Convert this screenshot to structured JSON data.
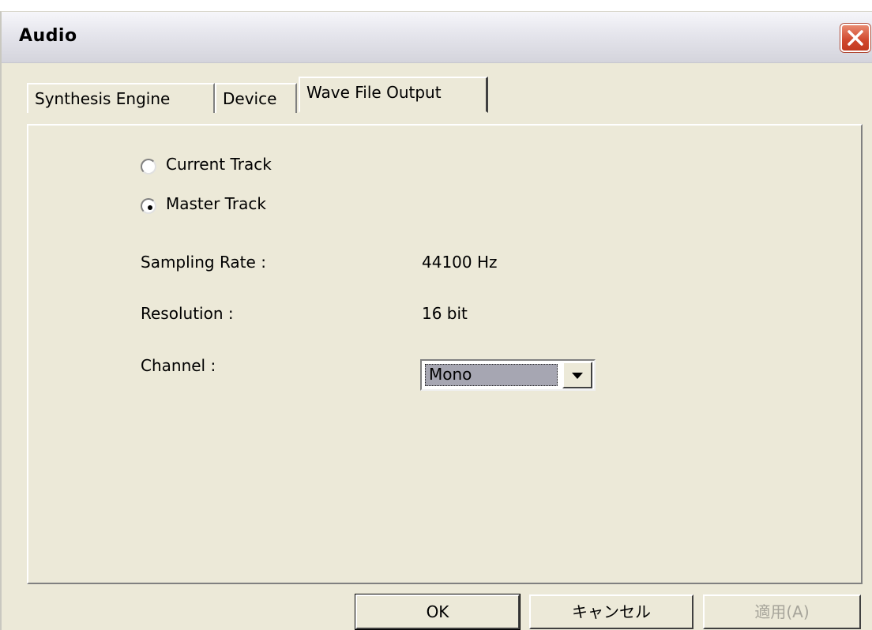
{
  "window": {
    "title": "Audio"
  },
  "tabs": [
    {
      "label": "Synthesis Engine",
      "active": false
    },
    {
      "label": "Device",
      "active": false
    },
    {
      "label": "Wave File Output",
      "active": true
    }
  ],
  "output_target": {
    "options": [
      {
        "label": "Current Track",
        "selected": false
      },
      {
        "label": "Master Track",
        "selected": true
      }
    ]
  },
  "fields": {
    "sampling_rate": {
      "label": "Sampling Rate :",
      "value": "44100 Hz"
    },
    "resolution": {
      "label": "Resolution :",
      "value": "16 bit"
    },
    "channel": {
      "label": "Channel :",
      "value": "Mono"
    }
  },
  "buttons": {
    "ok": "OK",
    "cancel": "キャンセル",
    "apply": "適用(A)"
  },
  "colors": {
    "dialog_bg": "#ece9d8",
    "close_button": "#d0472c",
    "selection_bg": "#a6a6b2"
  }
}
